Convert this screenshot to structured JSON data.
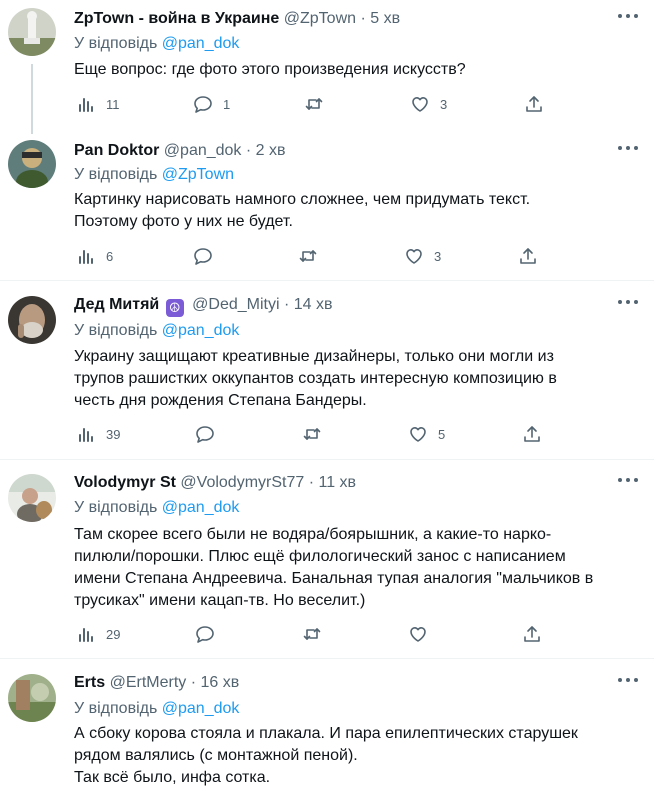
{
  "reply_prefix": "У відповідь",
  "tweets": [
    {
      "name": "ZpTown - война в Украине",
      "handle": "@ZpTown",
      "time": "5 хв",
      "reply_to": "@pan_dok",
      "lines": [
        "Еще вопрос: где фото этого произведения искусств?"
      ],
      "stats": "11",
      "replies": "1",
      "retweets": "",
      "likes": "3"
    },
    {
      "name": "Pan Doktor",
      "handle": "@pan_dok",
      "time": "2 хв",
      "reply_to": "@ZpTown",
      "lines": [
        "Картинку нарисовать намного сложнее, чем придумать текст.",
        "Поэтому фото у них не будет."
      ],
      "stats": "6",
      "replies": "",
      "retweets": "",
      "likes": "3"
    },
    {
      "name": "Дед Митяй",
      "badge": "☮",
      "handle": "@Ded_Mityi",
      "time": "14 хв",
      "reply_to": "@pan_dok",
      "lines": [
        "Украину защищают креативные дизайнеры, только они могли из",
        "трупов рашистких оккупантов создать интересную композицию в",
        "честь дня рождения Степана Бандеры."
      ],
      "stats": "39",
      "replies": "",
      "retweets": "",
      "likes": "5"
    },
    {
      "name": "Volodymyr St",
      "handle": "@VolodymyrSt77",
      "time": "11 хв",
      "reply_to": "@pan_dok",
      "lines": [
        "Там скорее всего были не водяра/боярышник, а какие-то нарко-",
        "пилюли/порошки. Плюс ещё филологический занос с написанием",
        "имени Степана Андреевича. Банальная тупая аналогия \"мальчиков в",
        "трусиках\" имени кацап-тв. Но веселит.)"
      ],
      "stats": "29",
      "replies": "",
      "retweets": "",
      "likes": ""
    },
    {
      "name": "Erts",
      "handle": "@ErtMerty",
      "time": "16 хв",
      "reply_to": "@pan_dok",
      "lines": [
        "А сбоку корова стояла и плакала. И пара епилептических старушек",
        "рядом валялись (с монтажной пеной).",
        "Так всё было, инфа сотка."
      ],
      "stats": "",
      "replies": "",
      "retweets": "",
      "likes": ""
    }
  ],
  "colors": {
    "link": "#1d9bf0",
    "muted": "#536471",
    "text": "#0f1419",
    "divider": "#eff3f4",
    "thread_line": "#cfd9de"
  },
  "icons": [
    "stats-icon",
    "reply-icon",
    "retweet-icon",
    "like-icon",
    "share-icon",
    "more-icon"
  ]
}
